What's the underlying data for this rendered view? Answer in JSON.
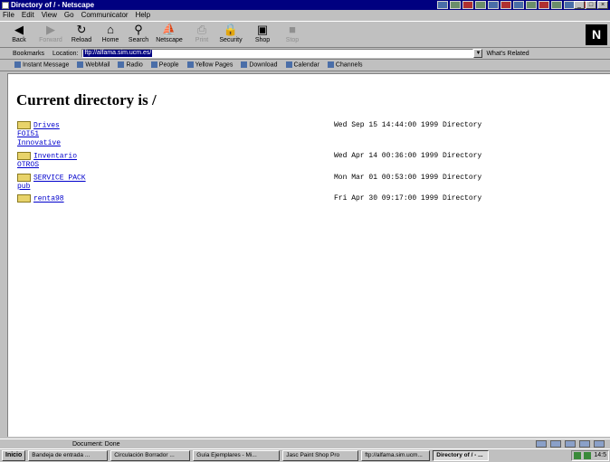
{
  "window": {
    "title": "Directory of / - Netscape"
  },
  "menu": [
    "File",
    "Edit",
    "View",
    "Go",
    "Communicator",
    "Help"
  ],
  "nav": [
    {
      "label": "Back",
      "icon": "back-arrow-icon",
      "glyph": "◀",
      "enabled": true
    },
    {
      "label": "Forward",
      "icon": "forward-arrow-icon",
      "glyph": "▶",
      "enabled": false
    },
    {
      "label": "Reload",
      "icon": "reload-icon",
      "glyph": "↻",
      "enabled": true
    },
    {
      "label": "Home",
      "icon": "home-icon",
      "glyph": "⌂",
      "enabled": true
    },
    {
      "label": "Search",
      "icon": "search-icon",
      "glyph": "⚲",
      "enabled": true
    },
    {
      "label": "Netscape",
      "icon": "netscape-icon",
      "glyph": "⛵",
      "enabled": true
    },
    {
      "label": "Print",
      "icon": "print-icon",
      "glyph": "⎙",
      "enabled": false
    },
    {
      "label": "Security",
      "icon": "lock-icon",
      "glyph": "🔒",
      "enabled": true
    },
    {
      "label": "Shop",
      "icon": "shop-icon",
      "glyph": "▣",
      "enabled": true
    },
    {
      "label": "Stop",
      "icon": "stop-icon",
      "glyph": "■",
      "enabled": false
    }
  ],
  "location": {
    "bookmarks_label": "Bookmarks",
    "location_label": "Location:",
    "url": "ftp://alfama.sim.ucm.es/",
    "related_label": "What's Related"
  },
  "personal": [
    "Instant Message",
    "WebMail",
    "Radio",
    "People",
    "Yellow Pages",
    "Download",
    "Calendar",
    "Channels"
  ],
  "page": {
    "heading": "Current directory is /",
    "entries": [
      {
        "name": "Drives",
        "meta": "Wed Sep 15 14:44:00 1999 Directory"
      },
      {
        "name": "Inventario",
        "meta": "Wed Apr 14 00:36:00 1999 Directory"
      },
      {
        "name": "SERVICE PACK",
        "meta": "Mon Mar 01 00:53:00 1999 Directory"
      },
      {
        "name": "renta98",
        "meta": "Fri Apr 30 09:17:00 1999 Directory"
      }
    ],
    "plain_links": [
      "FOI51",
      "Innovative",
      "OTROS",
      "pub"
    ]
  },
  "status": {
    "text": "Document: Done"
  },
  "taskbar": {
    "start": "Inicio",
    "tasks": [
      "Bandeja de entrada ...",
      "Circulación Borrador ...",
      "Guía Ejemplares - Mi...",
      "Jasc Paint Shop Pro",
      "ftp://alfama.sim.ucm...",
      "Directory of / - ..."
    ],
    "clock": "14:5"
  }
}
